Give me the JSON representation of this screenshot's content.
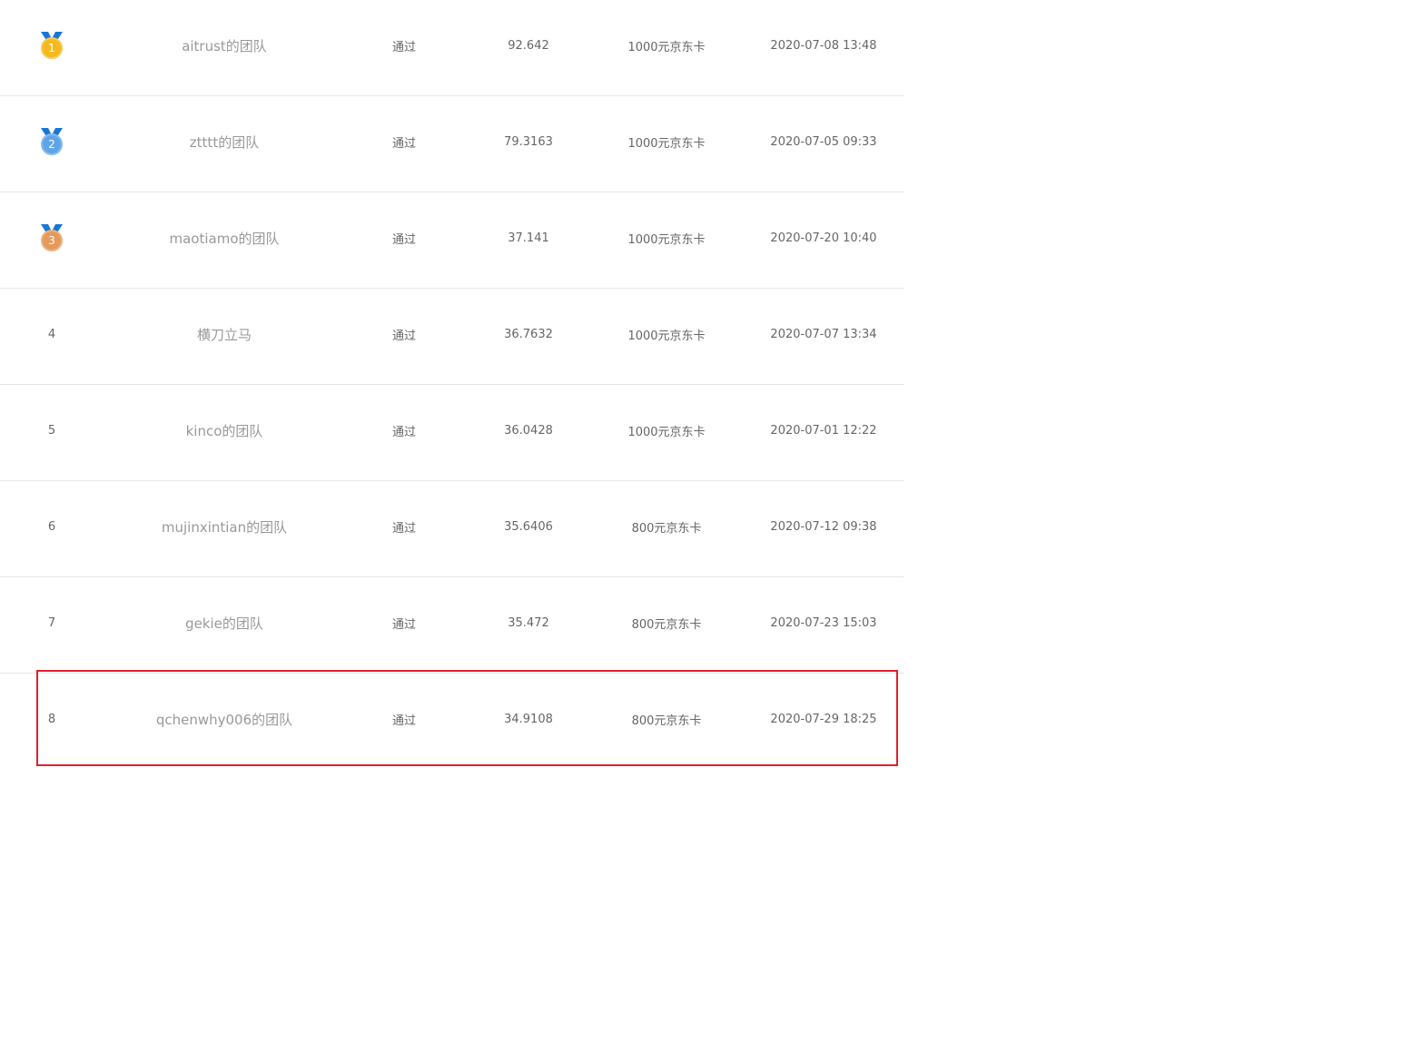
{
  "colors": {
    "gold": "#f5b81f",
    "silver": "#5fa4e8",
    "bronze": "#e59a5a",
    "ribbon": "#1677d9",
    "highlight": "#e0202a",
    "divider": "#e6e6e6"
  },
  "rows": [
    {
      "rank": "1",
      "medal": "gold-medal-icon",
      "team": "aitrust的团队",
      "status": "通过",
      "score": "92.642",
      "prize": "1000元京东卡",
      "time": "2020-07-08 13:48"
    },
    {
      "rank": "2",
      "medal": "silver-medal-icon",
      "team": "ztttt的团队",
      "status": "通过",
      "score": "79.3163",
      "prize": "1000元京东卡",
      "time": "2020-07-05 09:33"
    },
    {
      "rank": "3",
      "medal": "bronze-medal-icon",
      "team": "maotiamo的团队",
      "status": "通过",
      "score": "37.141",
      "prize": "1000元京东卡",
      "time": "2020-07-20 10:40"
    },
    {
      "rank": "4",
      "team": "横刀立马",
      "status": "通过",
      "score": "36.7632",
      "prize": "1000元京东卡",
      "time": "2020-07-07 13:34"
    },
    {
      "rank": "5",
      "team": "kinco的团队",
      "status": "通过",
      "score": "36.0428",
      "prize": "1000元京东卡",
      "time": "2020-07-01 12:22"
    },
    {
      "rank": "6",
      "team": "mujinxintian的团队",
      "status": "通过",
      "score": "35.6406",
      "prize": "800元京东卡",
      "time": "2020-07-12 09:38"
    },
    {
      "rank": "7",
      "team": "gekie的团队",
      "status": "通过",
      "score": "35.472",
      "prize": "800元京东卡",
      "time": "2020-07-23 15:03"
    },
    {
      "rank": "8",
      "team": "qchenwhy006的团队",
      "status": "通过",
      "score": "34.9108",
      "prize": "800元京东卡",
      "time": "2020-07-29 18:25"
    }
  ]
}
